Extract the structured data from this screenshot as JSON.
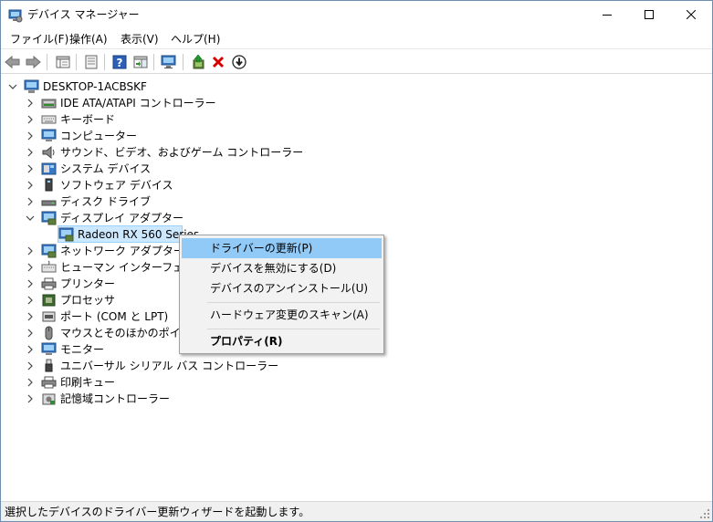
{
  "window": {
    "title": "デバイス マネージャー"
  },
  "menubar": {
    "items": [
      "ファイル(F)",
      "操作(A)",
      "表示(V)",
      "ヘルプ(H)"
    ]
  },
  "toolbar": {
    "buttons": [
      "back-icon",
      "forward-icon",
      "properties-icon",
      "show-hidden-icon",
      "help-icon",
      "action-icon",
      "monitor-scan-icon",
      "update-driver-icon",
      "uninstall-icon",
      "disable-icon"
    ]
  },
  "tree": {
    "root": "DESKTOP-1ACBSKF",
    "categories": [
      "IDE ATA/ATAPI コントローラー",
      "キーボード",
      "コンピューター",
      "サウンド、ビデオ、およびゲーム コントローラー",
      "システム デバイス",
      "ソフトウェア デバイス",
      "ディスク ドライブ",
      "ディスプレイ アダプター",
      "Radeon RX 560 Series",
      "ネットワーク アダプター",
      "ヒューマン インターフェイス デバ",
      "プリンター",
      "プロセッサ",
      "ポート (COM と LPT)",
      "マウスとそのほかのポインティ",
      "モニター",
      "ユニバーサル シリアル バス コントローラー",
      "印刷キュー",
      "記憶域コントローラー"
    ]
  },
  "context_menu": {
    "update_driver": "ドライバーの更新(P)",
    "disable_device": "デバイスを無効にする(D)",
    "uninstall_device": "デバイスのアンインストール(U)",
    "scan_hardware": "ハードウェア変更のスキャン(A)",
    "properties": "プロパティ(R)"
  },
  "statusbar": {
    "text": "選択したデバイスのドライバー更新ウィザードを起動します。"
  },
  "colors": {
    "selection": "#cce8ff",
    "menu_highlight": "#91c9f7",
    "uninstall_red": "#d40000"
  }
}
